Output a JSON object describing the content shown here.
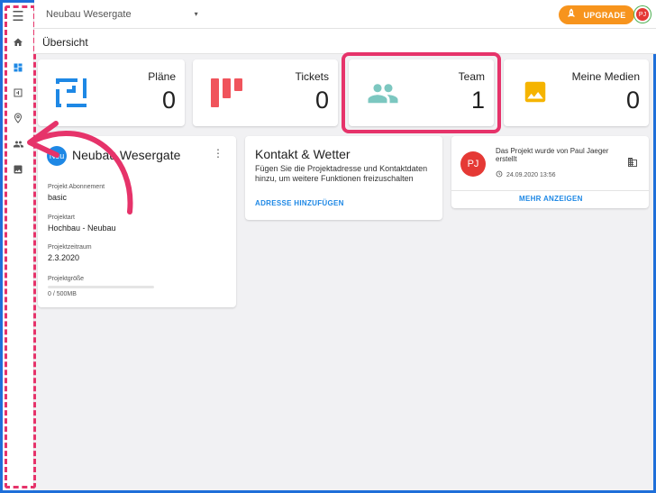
{
  "topbar": {
    "project_name": "Neubau Wesergate",
    "caret": "▾",
    "upgrade_label": "UPGRADE",
    "user_initials": "PJ"
  },
  "page_title": "Übersicht",
  "sidebar": {
    "items": [
      {
        "name": "menu-icon",
        "glyph": "☰"
      },
      {
        "name": "home-icon",
        "glyph": "⌂"
      },
      {
        "name": "dashboard-icon",
        "glyph": "▦"
      },
      {
        "name": "plans-icon",
        "glyph": "⊟"
      },
      {
        "name": "location-icon",
        "glyph": "⚲"
      },
      {
        "name": "team-icon",
        "glyph": "👥"
      },
      {
        "name": "media-icon",
        "glyph": "▣"
      }
    ]
  },
  "stats": [
    {
      "label": "Pläne",
      "value": "0",
      "icon": "plans-icon",
      "color": "#1e88e5"
    },
    {
      "label": "Tickets",
      "value": "0",
      "icon": "tickets-icon",
      "color": "#f0545c"
    },
    {
      "label": "Team",
      "value": "1",
      "icon": "team-icon",
      "color": "#7cc7c0"
    },
    {
      "label": "Meine Medien",
      "value": "0",
      "icon": "media-icon",
      "color": "#f5b400"
    }
  ],
  "project_card": {
    "badge": "Neu",
    "name": "Neubau Wesergate",
    "more": "⋮",
    "fields": [
      {
        "label": "Projekt Abonnement",
        "value": "basic"
      },
      {
        "label": "Projektart",
        "value": "Hochbau - Neubau"
      },
      {
        "label": "Projektzeitraum",
        "value": "2.3.2020"
      }
    ],
    "size_label": "Projektgröße",
    "size_value": "0 / 500MB",
    "size_fraction": 0.0
  },
  "contact_card": {
    "title": "Kontakt & Wetter",
    "text": "Fügen Sie die Projektadresse und Kontaktdaten hinzu, um weitere Funktionen freizuschalten",
    "link": "ADRESSE HINZUFÜGEN"
  },
  "activity_card": {
    "avatar": "PJ",
    "text": "Das Projekt wurde von Paul Jaeger erstellt",
    "time": "24.09.2020 13:56",
    "more_link": "MEHR ANZEIGEN"
  },
  "colors": {
    "highlight": "#e6336a",
    "accent": "#1e88e5",
    "upgrade": "#f7941d"
  }
}
